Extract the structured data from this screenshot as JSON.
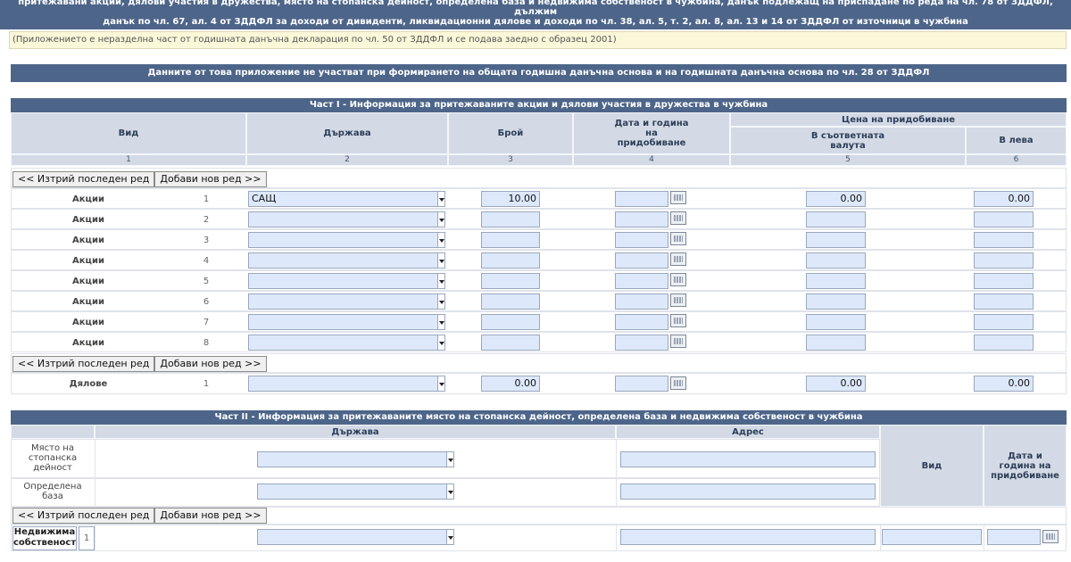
{
  "header": {
    "title_line1": "притежавани акции, дялови участия в дружества, място на стопанска дейност, определена база и недвижима собственост в чужбина, данък подлежащ на приспадане по реда на чл. 78 от ЗДДФЛ, дължим",
    "title_line2": "данък по чл. 67, ал. 4 от ЗДДФЛ за доходи от дивиденти, ликвидационни дялове и доходи по чл. 38, ал. 5, т. 2, ал. 8, ал. 13 и 14 от ЗДДФЛ от източници в чужбина",
    "note": "(Приложението е неразделна част от годишната данъчна декларация по чл. 50 от ЗДДФЛ и се подава заедно с образец 2001)",
    "banner": "Данните от това приложение не участват при формирането на общата годишна данъчна основа и на годишната данъчна основа по чл. 28 от ЗДДФЛ"
  },
  "part1": {
    "title": "Част I - Информация за притежаваните акции и дялови участия в дружества в чужбина",
    "col_vid": "Вид",
    "col_country": "Държава",
    "col_count": "Брой",
    "col_date": "Дата и година на придобиване",
    "col_price": "Цена на придобиване",
    "col_currency": "В съответната валута",
    "col_leva": "В лева",
    "num1": "1",
    "num2": "2",
    "num3": "3",
    "num4": "4",
    "num5": "5",
    "num6": "6",
    "btn_delete": "<< Изтрий последен ред",
    "btn_add": "Добави нов ред >>",
    "rows": [
      {
        "label": "Акции",
        "idx": "1",
        "country": "САЩ",
        "count": "10.00",
        "currency": "0.00",
        "leva": "0.00"
      },
      {
        "label": "Акции",
        "idx": "2",
        "country": "",
        "count": "",
        "currency": "",
        "leva": ""
      },
      {
        "label": "Акции",
        "idx": "3",
        "country": "",
        "count": "",
        "currency": "",
        "leva": ""
      },
      {
        "label": "Акции",
        "idx": "4",
        "country": "",
        "count": "",
        "currency": "",
        "leva": ""
      },
      {
        "label": "Акции",
        "idx": "5",
        "country": "",
        "count": "",
        "currency": "",
        "leva": ""
      },
      {
        "label": "Акции",
        "idx": "6",
        "country": "",
        "count": "",
        "currency": "",
        "leva": ""
      },
      {
        "label": "Акции",
        "idx": "7",
        "country": "",
        "count": "",
        "currency": "",
        "leva": ""
      },
      {
        "label": "Акции",
        "idx": "8",
        "country": "",
        "count": "",
        "currency": "",
        "leva": ""
      }
    ],
    "share_row": {
      "label": "Дялове",
      "idx": "1",
      "country": "",
      "count": "0.00",
      "currency": "0.00",
      "leva": "0.00"
    }
  },
  "part2": {
    "title": "Част II - Информация за притежаваните място на стопанска дейност, определена база и недвижима собственост в чужбина",
    "col_country": "Държава",
    "col_address": "Адрес",
    "col_vid": "Вид",
    "col_date": "Дата и година на придобиване",
    "row_business_l1": "Място на",
    "row_business_l2": "стопанска",
    "row_business_l3": "дейност",
    "row_base_l1": "Определена",
    "row_base_l2": "база",
    "property_l1": "Недвижима",
    "property_l2": "собственост",
    "property_idx": "1",
    "btn_delete": "<< Изтрий последен ред",
    "btn_add": "Добави нов ред >>"
  }
}
